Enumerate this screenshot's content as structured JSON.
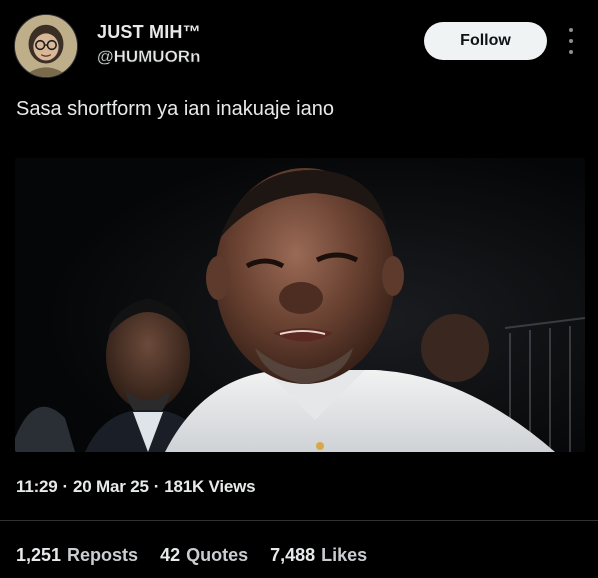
{
  "author": {
    "display_name": "JUST MIH™",
    "handle": "@HUMUORn"
  },
  "follow_label": "Follow",
  "tweet": {
    "text": "Sasa  shortform ya ian inakuaje iano"
  },
  "meta": {
    "time": "11:29",
    "date": "20 Mar 25",
    "views": "181K Views",
    "separator": "·"
  },
  "stats": {
    "reposts_count": "1,251",
    "reposts_label": "Reposts",
    "quotes_count": "42",
    "quotes_label": "Quotes",
    "likes_count": "7,488",
    "likes_label": "Likes"
  },
  "icons": {
    "more": "more-vertical-icon"
  },
  "colors": {
    "background": "#000000",
    "text": "#e7e9ea",
    "follow_bg": "#eff3f4",
    "divider": "#2f3336"
  }
}
